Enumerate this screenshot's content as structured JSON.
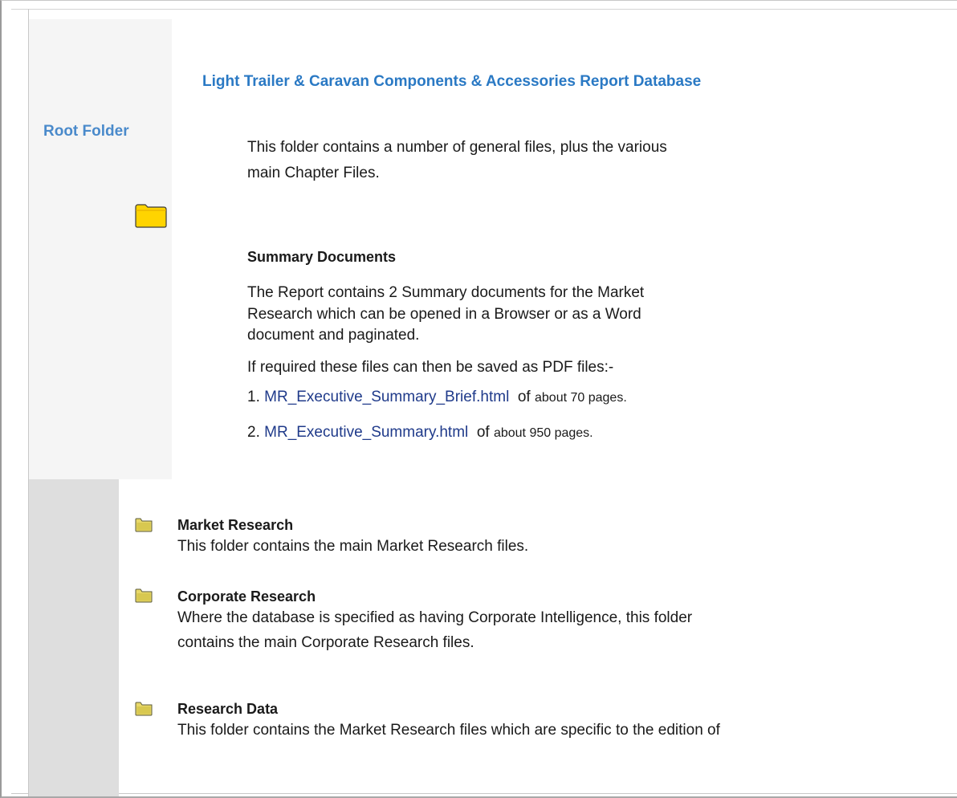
{
  "sidebar": {
    "root_label": "Root Folder"
  },
  "header": {
    "title": "Light Trailer & Caravan Components & Accessories Report Database"
  },
  "intro": {
    "line1": "This folder contains a number of general files, plus the various",
    "line2": "main Chapter Files."
  },
  "summary": {
    "heading": "Summary Documents",
    "desc_line1": "The Report contains 2 Summary documents for the Market",
    "desc_line2": "Research which can be opened in a Browser or as a Word",
    "desc_line3": "document and paginated.",
    "pdf_note": "If required these files can then be saved as PDF files:-",
    "files": [
      {
        "number": "1.",
        "name": "MR_Executive_Summary_Brief.html",
        "of": "of",
        "pages": "about 70 pages."
      },
      {
        "number": "2.",
        "name": "MR_Executive_Summary.html",
        "of": "of",
        "pages": "about 950 pages."
      }
    ]
  },
  "folders": [
    {
      "title": "Market Research",
      "desc": "This folder contains the main Market Research files."
    },
    {
      "title": "Corporate Research",
      "desc_line1": "Where the database is specified as having Corporate Intelligence, this folder",
      "desc_line2": "contains the main Corporate Research files."
    },
    {
      "title": "Research Data",
      "desc": "This folder contains the Market Research files which are specific to the edition of"
    }
  ],
  "icons": {
    "root_folder": "folder-icon",
    "item_folder": "folder-icon"
  },
  "colors": {
    "title_blue": "#2a79c4",
    "root_label_blue": "#4a8acb",
    "link_blue": "#1f3a8a",
    "folder_yellow": "#ffd700"
  }
}
